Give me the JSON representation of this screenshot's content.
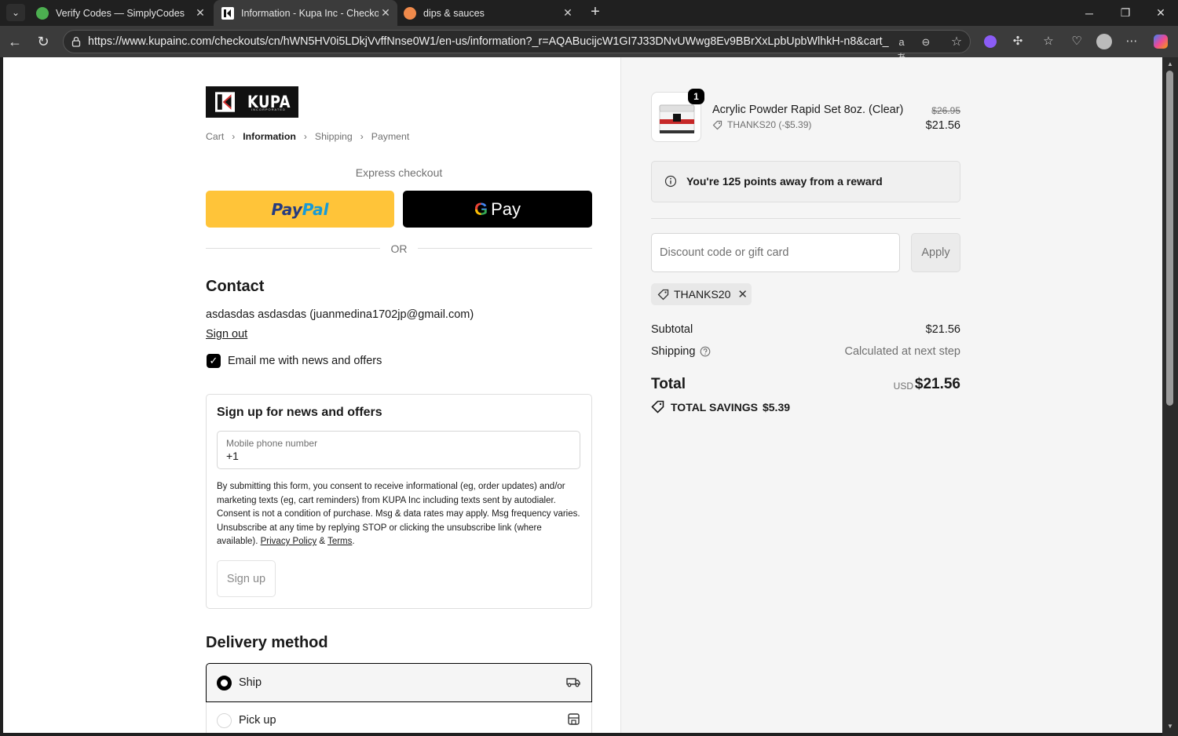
{
  "browser": {
    "tabs": [
      {
        "title": "Verify Codes — SimplyCodes",
        "favicon_color": "#4caf50"
      },
      {
        "title": "Information - Kupa Inc - Checkout",
        "favicon_color": "#ffffff"
      },
      {
        "title": "dips & sauces",
        "favicon_color": "#f08a4b"
      }
    ],
    "url": "https://www.kupainc.com/checkouts/cn/hWN5HV0i5LDkjVvffNnse0W1/en-us/information?_r=AQABucijcW1GI7J33DNvUWwg8Ev9BBrXxLpbUpbWlhkH-n8&cart_link_id...",
    "translate_glyph": "aあ"
  },
  "store": {
    "logo_text": "KUPA",
    "logo_subtext": "INCORPORATED"
  },
  "breadcrumb": {
    "cart": "Cart",
    "information": "Information",
    "shipping": "Shipping",
    "payment": "Payment"
  },
  "express": {
    "label": "Express checkout",
    "paypal_part1": "Pay",
    "paypal_part2": "Pal",
    "gpay_g": "G",
    "gpay_text": "Pay",
    "or": "OR"
  },
  "contact": {
    "heading": "Contact",
    "info": "asdasdas asdasdas (juanmedina1702jp@gmail.com)",
    "sign_out": "Sign out",
    "email_checkbox_label": "Email me with news and offers",
    "email_checked": true
  },
  "signup": {
    "heading": "Sign up for news and offers",
    "phone_label": "Mobile phone number",
    "phone_value": "+1",
    "consent_text": "By submitting this form, you consent to receive informational (eg, order updates) and/or marketing texts (eg, cart reminders) from KUPA Inc including texts sent by autodialer. Consent is not a condition of purchase. Msg & data rates may apply. Msg frequency varies. Unsubscribe at any time by replying STOP or clicking the unsubscribe link (where available).",
    "privacy_link": "Privacy Policy",
    "amp": "&",
    "terms_link": "Terms",
    "period": ".",
    "button": "Sign up"
  },
  "delivery": {
    "heading": "Delivery method",
    "ship": "Ship",
    "pickup": "Pick up",
    "selected": "Ship"
  },
  "order": {
    "product": {
      "name": "Acrylic Powder Rapid Set 8oz. (Clear)",
      "quantity": "1",
      "discount": "THANKS20 (-$5.39)",
      "original_price": "$26.95",
      "price": "$21.56"
    },
    "reward": "You're 125 points away from a reward",
    "discount_placeholder": "Discount code or gift card",
    "apply": "Apply",
    "applied_code": "THANKS20",
    "subtotal_label": "Subtotal",
    "subtotal": "$21.56",
    "shipping_label": "Shipping",
    "shipping_value": "Calculated at next step",
    "total_label": "Total",
    "currency": "USD",
    "total": "$21.56",
    "savings_label": "TOTAL SAVINGS",
    "savings": "$5.39"
  },
  "colors": {
    "paypal_yellow": "#ffc439",
    "accent": "#000000",
    "sidebar_bg": "#f5f5f5"
  }
}
